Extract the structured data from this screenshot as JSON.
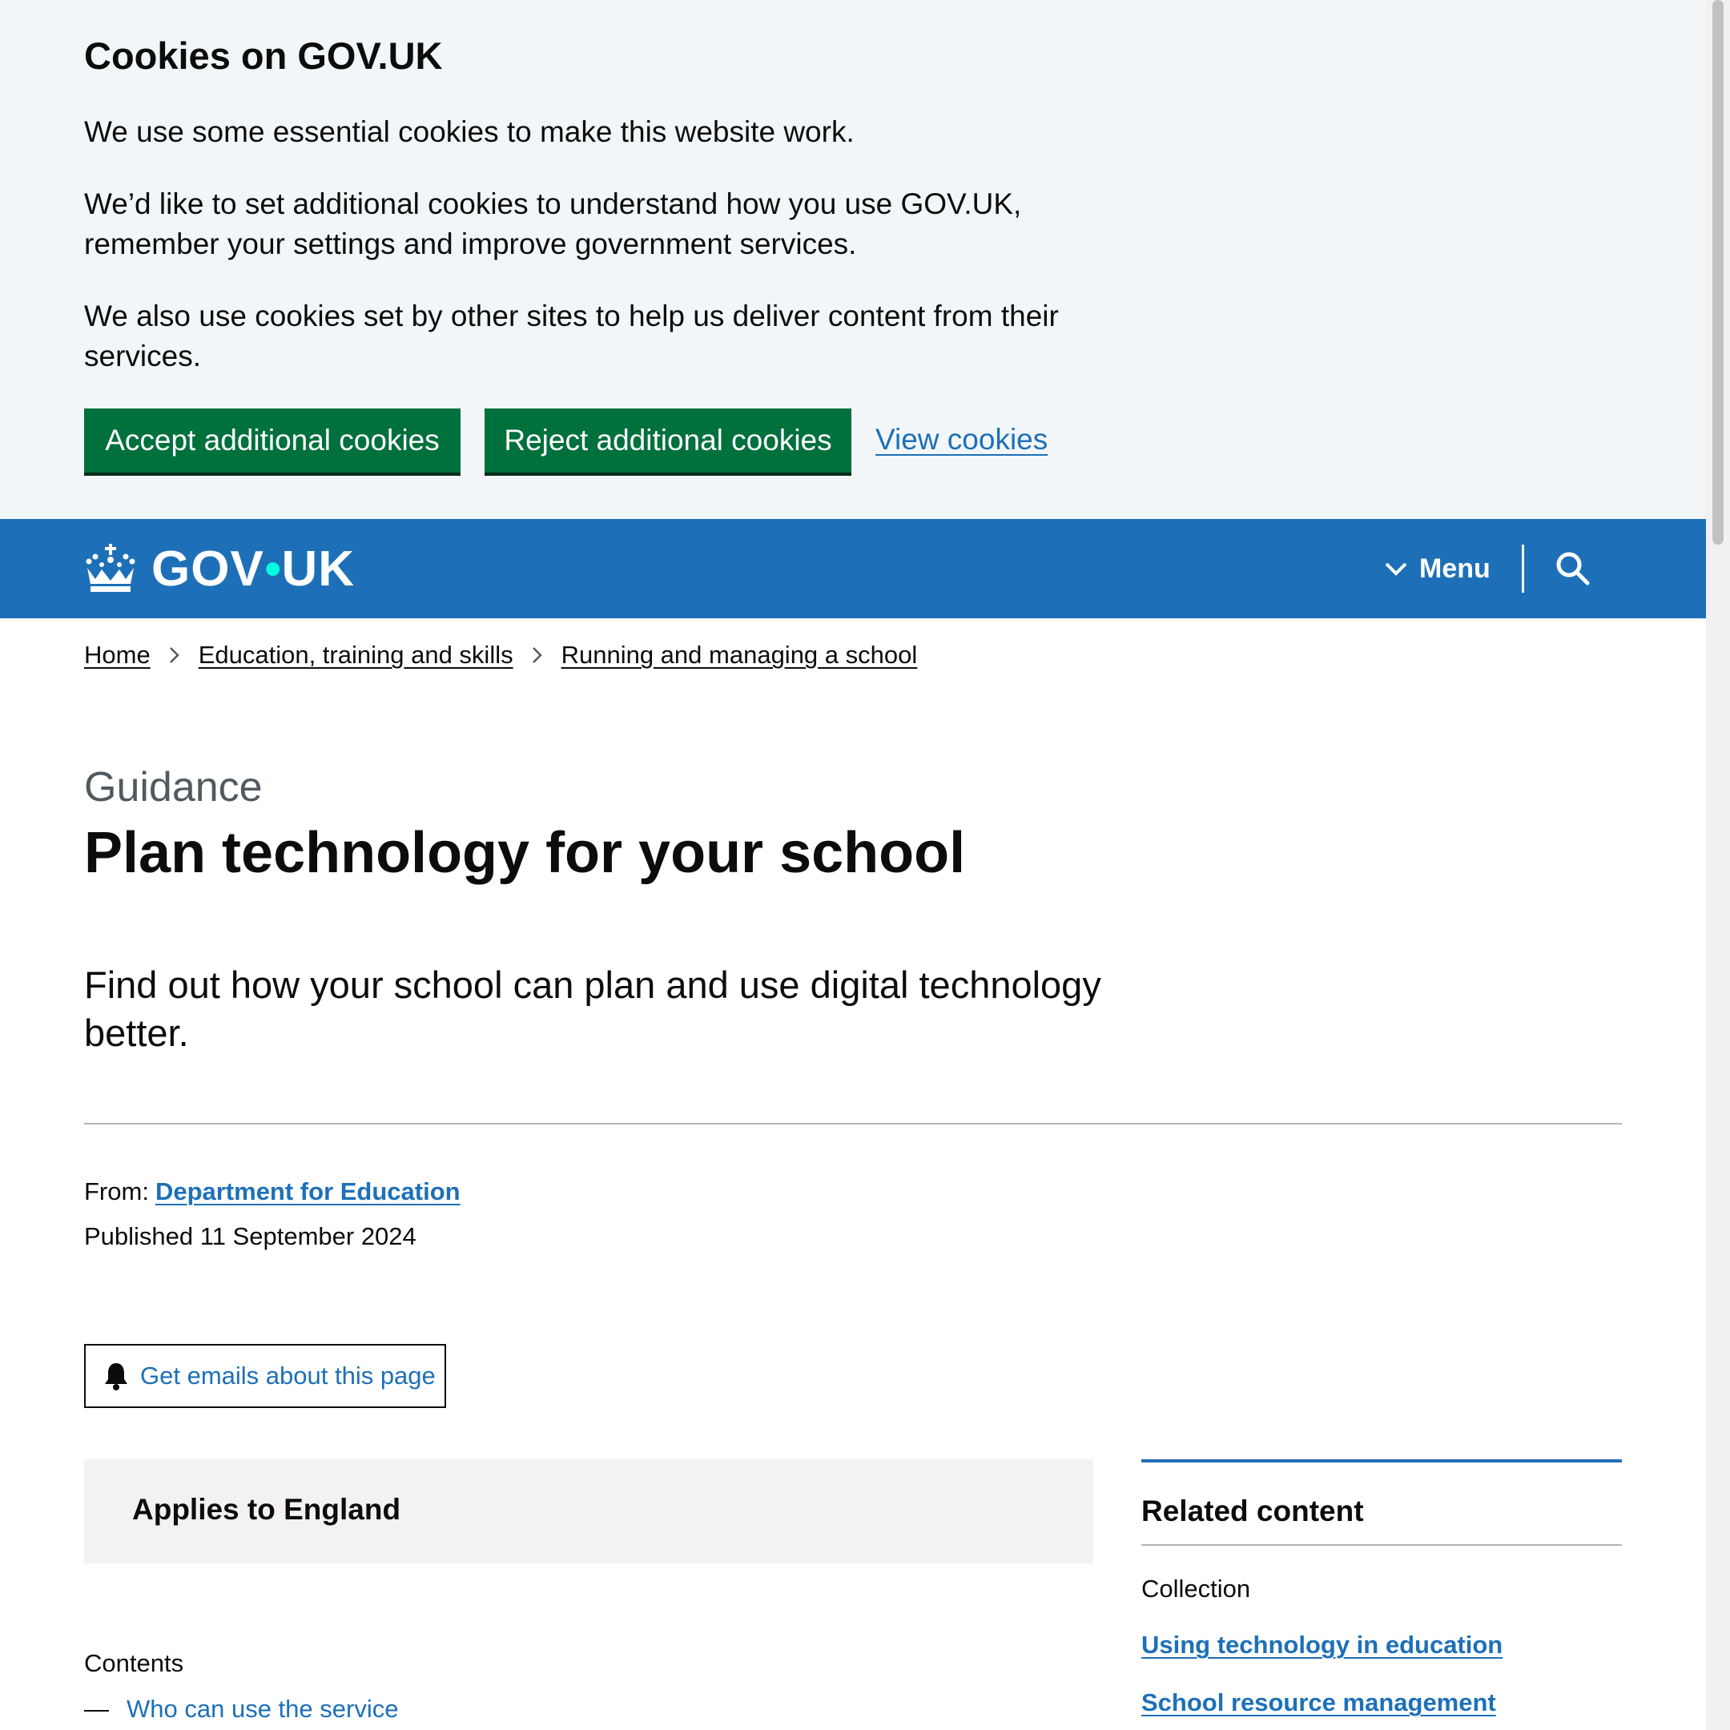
{
  "cookie_banner": {
    "title": "Cookies on GOV.UK",
    "p1": "We use some essential cookies to make this website work.",
    "p2": "We’d like to set additional cookies to understand how you use GOV.UK, remember your settings and improve government services.",
    "p3": "We also use cookies set by other sites to help us deliver content from their services.",
    "accept_label": "Accept additional cookies",
    "reject_label": "Reject additional cookies",
    "view_label": "View cookies"
  },
  "header": {
    "logo_left": "GOV",
    "logo_dot": "•",
    "logo_right": "UK",
    "menu_label": "Menu",
    "menu_icon": "chevron-down-icon",
    "search_icon": "search-icon",
    "crown_icon": "crown-icon"
  },
  "breadcrumb": {
    "items": [
      "Home",
      "Education, training and skills",
      "Running and managing a school"
    ]
  },
  "page": {
    "caption": "Guidance",
    "title": "Plan technology for your school",
    "lead": "Find out how your school can plan and use digital technology better.",
    "from_label": "From:",
    "from_org": "Department for Education",
    "published": "Published 11 September 2024",
    "emails_label": "Get emails about this page",
    "emails_icon": "bell-icon",
    "applies_to": "Applies to England",
    "contents_label": "Contents",
    "contents_dash": "—",
    "contents_items": [
      "Who can use the service"
    ]
  },
  "related": {
    "title": "Related content",
    "label": "Collection",
    "links": [
      "Using technology in education",
      "School resource management"
    ]
  },
  "colors": {
    "header_blue": "#1d70b8",
    "button_green": "#00703c",
    "banner_bg": "#f3f6f9",
    "link_blue": "#1d70b8",
    "inset_bg": "#f3f2f1",
    "logo_dot": "#00ffe0"
  }
}
